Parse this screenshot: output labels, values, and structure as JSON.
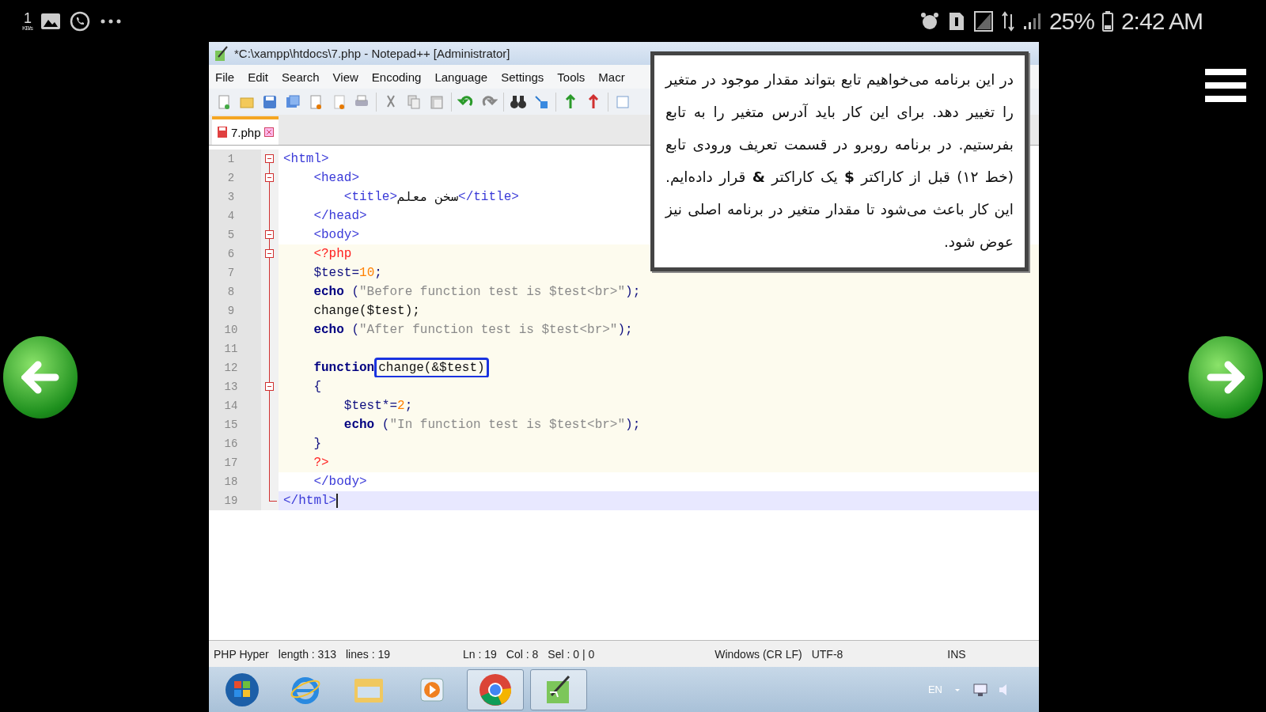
{
  "phone_status": {
    "speed_value": "1",
    "speed_unit": "KB/s",
    "battery": "25%",
    "time": "2:42 AM"
  },
  "window": {
    "title": "*C:\\xampp\\htdocs\\7.php - Notepad++ [Administrator]"
  },
  "menu": [
    "File",
    "Edit",
    "Search",
    "View",
    "Encoding",
    "Language",
    "Settings",
    "Tools",
    "Macr"
  ],
  "tabs": [
    {
      "label": "7.php",
      "selected": true
    }
  ],
  "editor": {
    "lines": [
      {
        "number": "1",
        "fold": true,
        "php": false,
        "current": false,
        "segments": [
          {
            "kind": "tag",
            "text": "<html>"
          }
        ]
      },
      {
        "number": "2",
        "fold": true,
        "php": false,
        "current": false,
        "segments": [
          {
            "kind": "tag",
            "text": "    <head>"
          }
        ]
      },
      {
        "number": "3",
        "fold": false,
        "php": false,
        "current": false,
        "segments": [
          {
            "kind": "tag",
            "text": "        <title>"
          },
          {
            "kind": "plain",
            "text": "سخن معلم"
          },
          {
            "kind": "tag",
            "text": "</title>"
          }
        ]
      },
      {
        "number": "4",
        "fold": false,
        "php": false,
        "current": false,
        "segments": [
          {
            "kind": "tag",
            "text": "    </head>"
          }
        ]
      },
      {
        "number": "5",
        "fold": true,
        "php": false,
        "current": false,
        "segments": [
          {
            "kind": "tag",
            "text": "    <body>"
          }
        ]
      },
      {
        "number": "6",
        "fold": true,
        "php": true,
        "current": false,
        "segments": [
          {
            "kind": "php",
            "text": "    <?php"
          }
        ]
      },
      {
        "number": "7",
        "fold": false,
        "php": true,
        "current": false,
        "segments": [
          {
            "kind": "var",
            "text": "    $test"
          },
          {
            "kind": "op",
            "text": "="
          },
          {
            "kind": "num",
            "text": "10"
          },
          {
            "kind": "op",
            "text": ";"
          }
        ]
      },
      {
        "number": "8",
        "fold": false,
        "php": true,
        "current": false,
        "segments": [
          {
            "kind": "keyword",
            "text": "    echo"
          },
          {
            "kind": "op",
            "text": " ("
          },
          {
            "kind": "string",
            "text": "\"Before function test is $test<br>\""
          },
          {
            "kind": "op",
            "text": ");"
          }
        ]
      },
      {
        "number": "9",
        "fold": false,
        "php": true,
        "current": false,
        "segments": [
          {
            "kind": "plain",
            "text": "    change($test);"
          }
        ]
      },
      {
        "number": "10",
        "fold": false,
        "php": true,
        "current": false,
        "segments": [
          {
            "kind": "keyword",
            "text": "    echo"
          },
          {
            "kind": "op",
            "text": " ("
          },
          {
            "kind": "string",
            "text": "\"After function test is $test<br>\""
          },
          {
            "kind": "op",
            "text": ");"
          }
        ]
      },
      {
        "number": "11",
        "fold": false,
        "php": true,
        "current": false
      },
      {
        "number": "12",
        "fold": false,
        "php": true,
        "current": false,
        "segments": [
          {
            "kind": "keyword",
            "text": "    function"
          },
          {
            "kind": "boxed",
            "text": "change(&$test)"
          }
        ]
      },
      {
        "number": "13",
        "fold": true,
        "php": true,
        "current": false,
        "segments": [
          {
            "kind": "op",
            "text": "    {"
          }
        ]
      },
      {
        "number": "14",
        "fold": false,
        "php": true,
        "current": false,
        "segments": [
          {
            "kind": "var",
            "text": "        $test"
          },
          {
            "kind": "op",
            "text": "*="
          },
          {
            "kind": "num",
            "text": "2"
          },
          {
            "kind": "op",
            "text": ";"
          }
        ]
      },
      {
        "number": "15",
        "fold": false,
        "php": true,
        "current": false,
        "segments": [
          {
            "kind": "keyword",
            "text": "        echo"
          },
          {
            "kind": "op",
            "text": " ("
          },
          {
            "kind": "string",
            "text": "\"In function test is $test<br>\""
          },
          {
            "kind": "op",
            "text": ");"
          }
        ]
      },
      {
        "number": "16",
        "fold": false,
        "php": true,
        "current": false,
        "segments": [
          {
            "kind": "op",
            "text": "    }"
          }
        ]
      },
      {
        "number": "17",
        "fold": false,
        "php": true,
        "current": false,
        "segments": [
          {
            "kind": "php",
            "text": "    ?>"
          }
        ]
      },
      {
        "number": "18",
        "fold": false,
        "php": false,
        "current": false,
        "segments": [
          {
            "kind": "tag",
            "text": "    </body>"
          }
        ]
      },
      {
        "number": "19",
        "fold": false,
        "php": false,
        "current": true,
        "segments": [
          {
            "kind": "tag",
            "text": "</html>"
          }
        ]
      }
    ]
  },
  "note": "در این برنامه می‌خواهیم تابع بتواند مقدار موجود در متغیر را تغییر دهد. برای این کار باید آدرس متغیر را به تابع بفرستیم. در برنامه روبرو در قسمت تعریف ورودی تابع (خط ۱۲) قبل از کاراکتر **$** یک کاراکتر **&** قرار داده‌ایم. این کار باعث می‌شود تا مقدار متغیر در برنامه اصلی نیز عوض شود.",
  "status_bar": [
    "PHP Hyper",
    "length : 313",
    "lines : 19",
    "Ln : 19",
    "Col : 8",
    "Sel : 0 | 0",
    "Windows (CR LF)",
    "UTF-8",
    "INS"
  ],
  "taskbar": {
    "items": [
      {
        "kind": "start",
        "running": false
      },
      {
        "kind": "ie",
        "running": false
      },
      {
        "kind": "folder",
        "running": false
      },
      {
        "kind": "media",
        "running": false
      },
      {
        "kind": "chrome",
        "running": true
      },
      {
        "kind": "notepad",
        "running": true
      }
    ],
    "tray": {
      "language": "EN"
    }
  }
}
